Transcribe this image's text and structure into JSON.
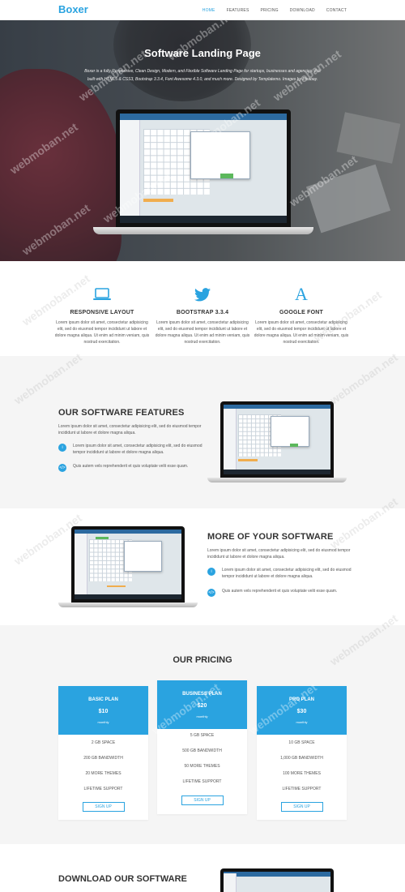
{
  "nav": {
    "brand": "Boxer",
    "items": [
      "HOME",
      "FEATURES",
      "PRICING",
      "DOWNLOAD",
      "CONTACT"
    ],
    "active_index": 0
  },
  "hero": {
    "title": "Software Landing Page",
    "subtitle": "Boxer is a fully Responsive, Clean Design, Modern, and Flexible Software Landing Page for startups, businesses and agencies. It is built with HTML5 & CSS3, Bootstrap 3.3.4, Font Awesome 4.3.0, and much more. Designed by Templatemo. Images by Pixabay."
  },
  "features": [
    {
      "icon": "laptop-icon",
      "title": "RESPONSIVE LAYOUT",
      "text": "Lorem ipsum dolor sit amet, consectetur adipisicing elit, sed do eiusmod tempor incididunt ut labore et dolore magna aliqua. Ut enim ad minim veniam, quis nostrud exercitation."
    },
    {
      "icon": "twitter-icon",
      "title": "BOOTSTRAP 3.3.4",
      "text": "Lorem ipsum dolor sit amet, consectetur adipisicing elit, sed do eiusmod tempor incididunt ut labore et dolore magna aliqua. Ut enim ad minim veniam, quis nostrud exercitation."
    },
    {
      "icon": "font-icon",
      "title": "GOOGLE FONT",
      "text": "Lorem ipsum dolor sit amet, consectetur adipisicing elit, sed do eiusmod tempor incididunt ut labore et dolore magna aliqua. Ut enim ad minim veniam, quis nostrud exercitation."
    }
  ],
  "software_features": {
    "title": "OUR SOFTWARE FEATURES",
    "lead": "Lorem ipsum dolor sit amet, consectetur adipisicing elit, sed do eiusmod tempor incididunt ut labore et dolore magna aliqua.",
    "bullets": [
      {
        "icon": "info-icon",
        "text": "Lorem ipsum dolor sit amet, consectetur adipisicing elit, sed do eiusmod tempor incididunt ut labore et dolore magna aliqua."
      },
      {
        "icon": "code-icon",
        "text": "Quis autem vels reprehenderit et quis voluptate velit esse quam."
      }
    ]
  },
  "more_software": {
    "title": "MORE OF YOUR SOFTWARE",
    "lead": "Lorem ipsum dolor sit amet, consectetur adipisicing elit, sed do eiusmod tempor incididunt ut labore et dolore magna aliqua.",
    "bullets": [
      {
        "icon": "info-icon",
        "text": "Lorem ipsum dolor sit amet, consectetur adipisicing elit, sed do eiusmod tempor incididunt ut labore et dolore magna aliqua."
      },
      {
        "icon": "code-icon",
        "text": "Quis autem vels reprehenderit et quis voluptate velit esse quam."
      }
    ]
  },
  "pricing": {
    "title": "OUR PRICING",
    "plans": [
      {
        "name": "BASIC PLAN",
        "price": "$10",
        "period": "monthly",
        "items": [
          "2 GB SPACE",
          "200 GB BANDWIDTH",
          "20 MORE THEMES",
          "LIFETIME SUPPORT"
        ],
        "button": "SIGN UP"
      },
      {
        "name": "BUSINESS PLAN",
        "price": "$20",
        "period": "monthly",
        "items": [
          "5 GB SPACE",
          "500 GB BANDWIDTH",
          "50 MORE THEMES",
          "LIFETIME SUPPORT"
        ],
        "button": "SIGN UP"
      },
      {
        "name": "PRO PLAN",
        "price": "$30",
        "period": "monthly",
        "items": [
          "10 GB SPACE",
          "1,000 GB BANDWIDTH",
          "100 MORE THEMES",
          "LIFETIME SUPPORT"
        ],
        "button": "SIGN UP"
      }
    ]
  },
  "download": {
    "title": "DOWNLOAD OUR SOFTWARE"
  },
  "watermark": "webmoban.net",
  "colors": {
    "accent": "#2aa3e0",
    "section_gray": "#f5f5f5"
  }
}
